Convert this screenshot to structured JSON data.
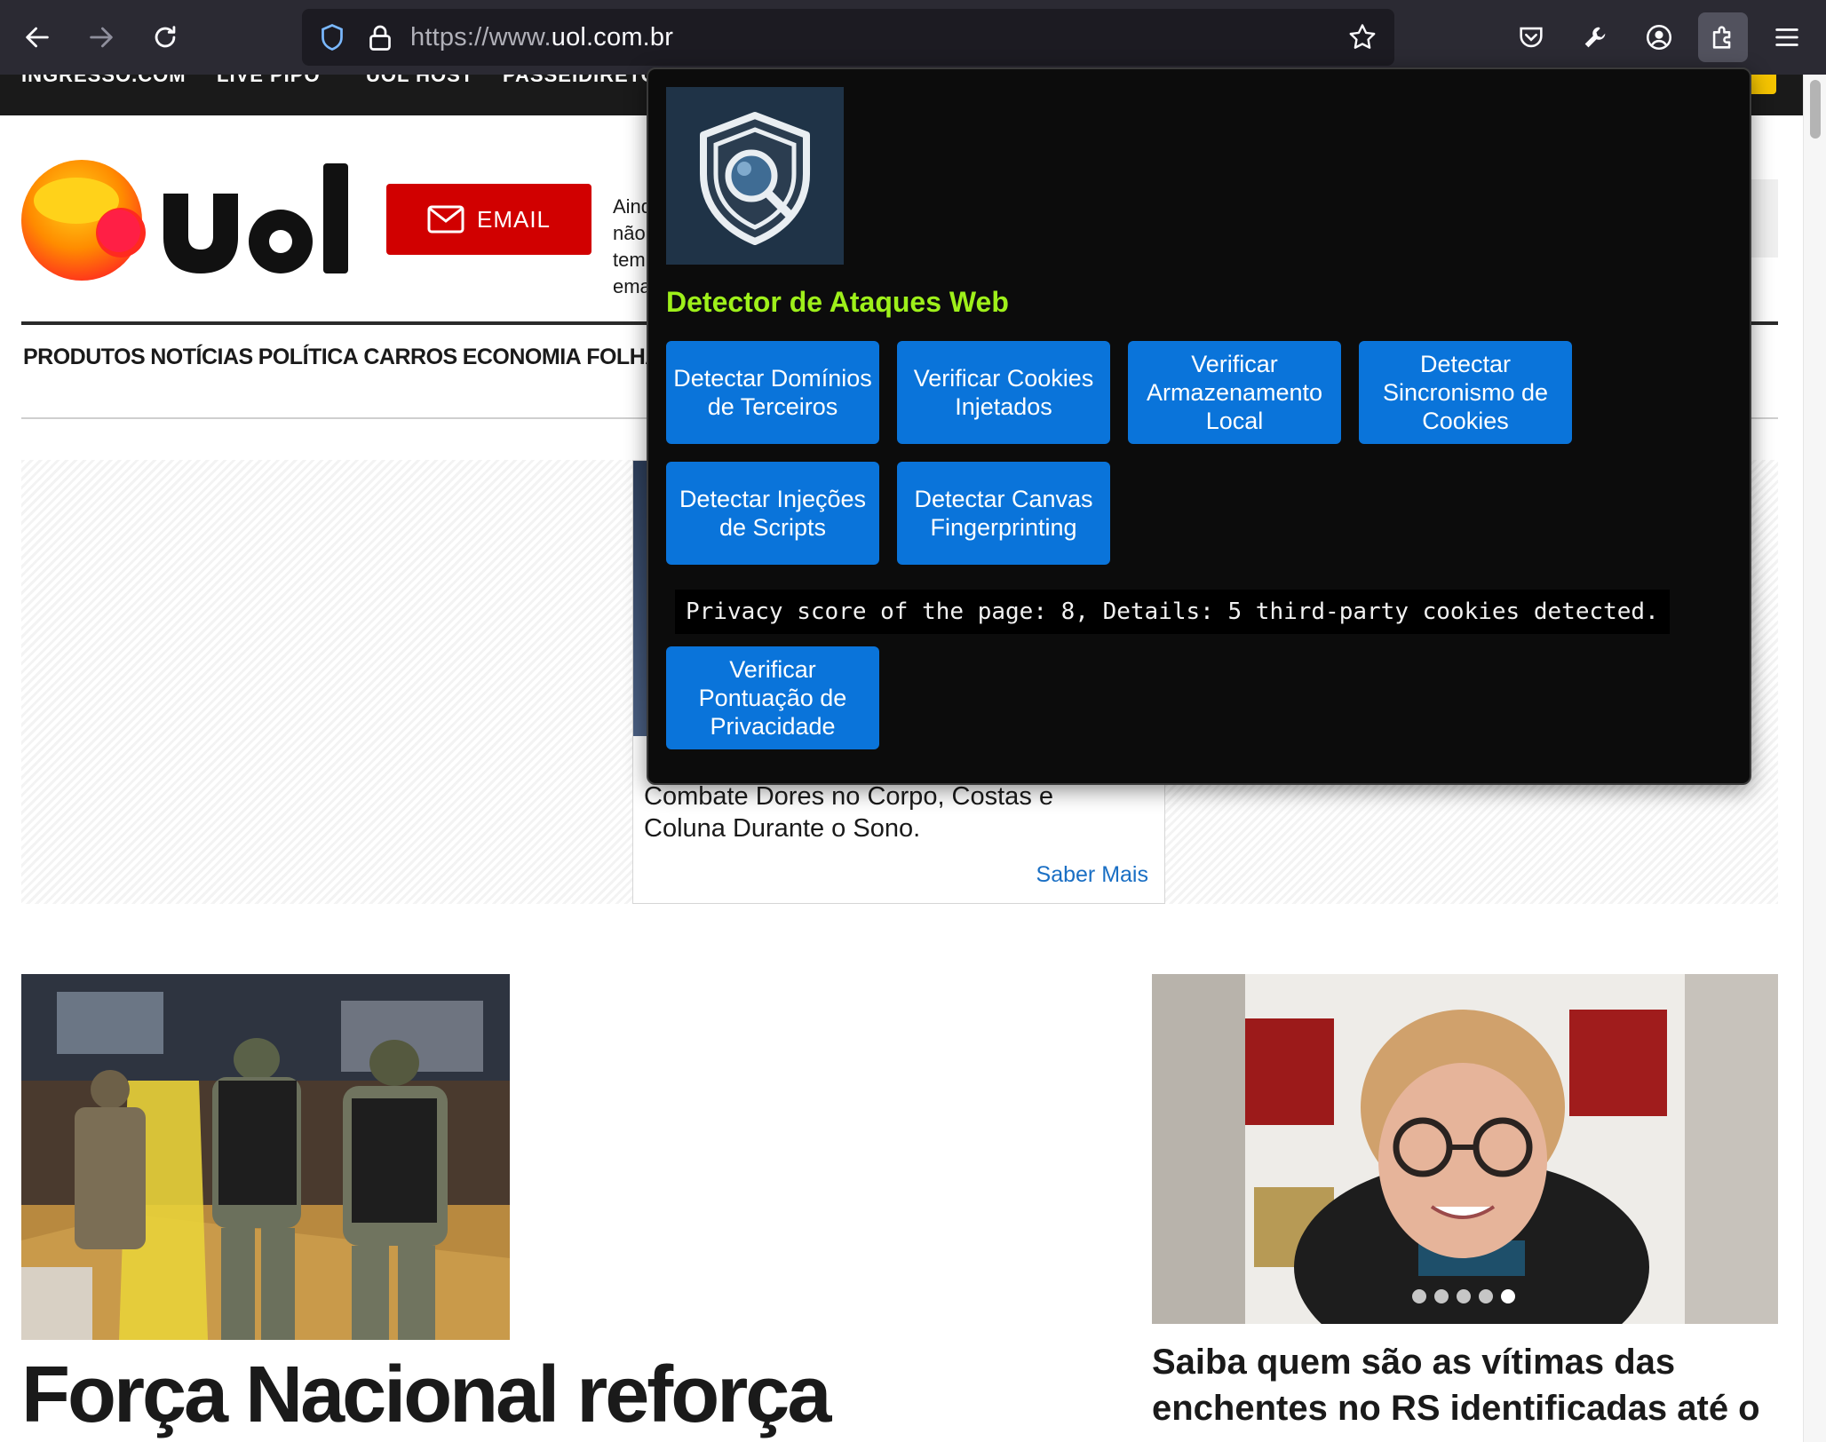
{
  "browser": {
    "url_prefix": "https://www.",
    "url_domain": "uol.com.br",
    "accent": "#2b2a33"
  },
  "page": {
    "top_strip": [
      "INGRESSO.COM",
      "LIVE PIPO",
      "UOL HOST",
      "PASSEIDIRETO"
    ],
    "email_button": "EMAIL",
    "email_side": "Ainda não tem email?",
    "nav": [
      "PRODUTOS",
      "NOTÍCIAS",
      "POLÍTICA",
      "CARROS",
      "ECONOMIA",
      "FOLHA"
    ],
    "ad": {
      "text_line1": "Combate Dores no Corpo, Costas e",
      "text_line2": "Coluna Durante o Sono.",
      "more": "Saber Mais"
    },
    "headline_left": "Força Nacional reforça",
    "headline_right": "Saiba quem são as vítimas das enchentes no RS identificadas até o",
    "carousel_dots": 5,
    "carousel_active": 5,
    "colors": {
      "email_red": "#d10000",
      "link_blue": "#1a6fc4"
    }
  },
  "popup": {
    "title": "Detector de Ataques Web",
    "icon": "shield-magnifier-icon",
    "buttons": [
      "Detectar Domínios de Terceiros",
      "Verificar Cookies Injetados",
      "Verificar Armazenamento Local",
      "Detectar Sincronismo de Cookies",
      "Detectar Injeções de Scripts",
      "Detectar Canvas Fingerprinting",
      "Verificar Pontuação de Privacidade"
    ],
    "result": "Privacy score of the page: 8, Details: 5 third-party cookies detected.",
    "colors": {
      "background": "#0c0c0c",
      "title": "#9ef01a",
      "button": "#0a74da"
    }
  }
}
